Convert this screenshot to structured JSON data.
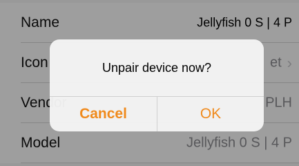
{
  "rows": [
    {
      "label": "Name",
      "value": "Jellyfish 0 S | 4 P"
    },
    {
      "label": "Icon",
      "value": "et",
      "has_chevron": true
    },
    {
      "label": "Vendor",
      "value": "PLH"
    },
    {
      "label": "Model",
      "value": "Jellyfish 0 S | 4 P"
    }
  ],
  "alert": {
    "message": "Unpair device now?",
    "cancel_label": "Cancel",
    "ok_label": "OK"
  },
  "colors": {
    "accent": "#f08a1c",
    "chevron": "#c7c7cc",
    "muted_value": "#8e8e93"
  },
  "icons": {
    "chevron": "chevron-right-icon"
  }
}
